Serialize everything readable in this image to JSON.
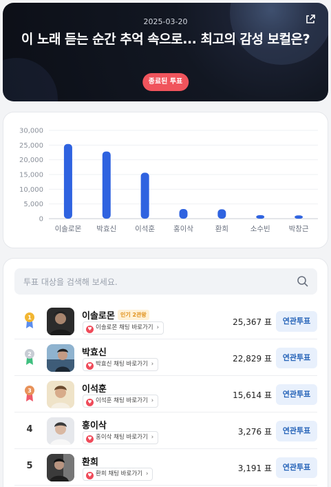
{
  "hero": {
    "date": "2025-03-20",
    "title": "이 노래 듣는 순간 추억 속으로... 최고의 감성 보컬은?",
    "status_badge": "종료된 투표"
  },
  "search": {
    "placeholder": "투표 대상을 검색해 보세요."
  },
  "chart_data": {
    "type": "bar",
    "categories": [
      "이솔로몬",
      "박효신",
      "이석훈",
      "홍이삭",
      "환희",
      "소수빈",
      "박창근"
    ],
    "values": [
      25367,
      22829,
      15614,
      3276,
      3191,
      1200,
      1100
    ],
    "ylim": [
      0,
      30000
    ],
    "yticks": [
      0,
      5000,
      10000,
      15000,
      20000,
      25000,
      30000
    ],
    "ytick_labels": [
      "0",
      "5,000",
      "10,000",
      "15,000",
      "20,000",
      "25,000",
      "30,000"
    ],
    "bar_color": "#2f63e0",
    "grid": true
  },
  "candidates": [
    {
      "rank": "1",
      "name": "이솔로몬",
      "popular_badge": "인기 2관왕",
      "channel_link": "이솔로몬 채팅 바로가기",
      "votes": "25,367 표",
      "vote_button": "연관투표",
      "medal_color": "#f2b632"
    },
    {
      "rank": "2",
      "name": "박효신",
      "channel_link": "박효신 채팅 바로가기",
      "votes": "22,829 표",
      "vote_button": "연관투표",
      "medal_color": "#c7ccd4"
    },
    {
      "rank": "3",
      "name": "이석훈",
      "channel_link": "이석훈 채팅 바로가기",
      "votes": "15,614 표",
      "vote_button": "연관투표",
      "medal_color": "#e8925a"
    },
    {
      "rank": "4",
      "name": "홍이삭",
      "channel_link": "홍이삭 채팅 바로가기",
      "votes": "3,276 표",
      "vote_button": "연관투표"
    },
    {
      "rank": "5",
      "name": "환희",
      "channel_link": "환희 채팅 바로가기",
      "votes": "3,191 표",
      "vote_button": "연관투표"
    }
  ]
}
